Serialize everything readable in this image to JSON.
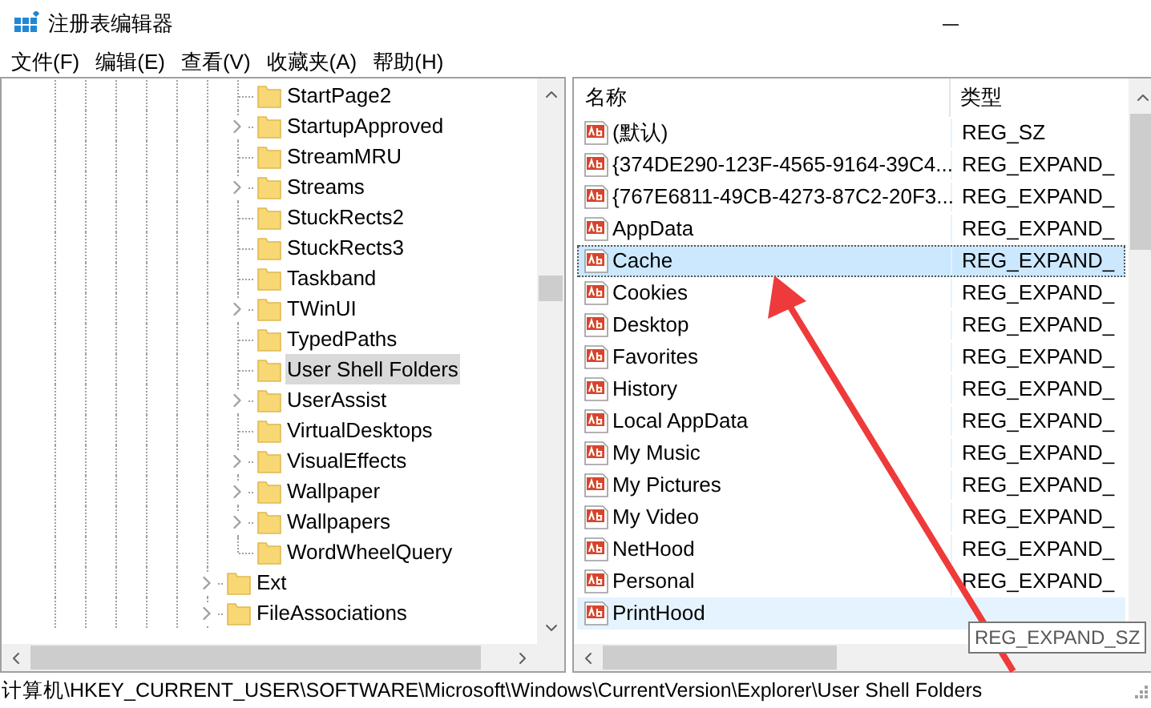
{
  "window": {
    "title": "注册表编辑器"
  },
  "menu": [
    {
      "label": "文件(F)"
    },
    {
      "label": "编辑(E)"
    },
    {
      "label": "查看(V)"
    },
    {
      "label": "收藏夹(A)"
    },
    {
      "label": "帮助(H)"
    }
  ],
  "tree": {
    "nodes": [
      {
        "children": [
          {
            "label": "StartPage2",
            "expandable": false,
            "selected": false
          },
          {
            "label": "StartupApproved",
            "expandable": true,
            "selected": false
          },
          {
            "label": "StreamMRU",
            "expandable": false,
            "selected": false
          },
          {
            "label": "Streams",
            "expandable": true,
            "selected": false
          },
          {
            "label": "StuckRects2",
            "expandable": false,
            "selected": false
          },
          {
            "label": "StuckRects3",
            "expandable": false,
            "selected": false
          },
          {
            "label": "Taskband",
            "expandable": false,
            "selected": false
          },
          {
            "label": "TWinUI",
            "expandable": true,
            "selected": false
          },
          {
            "label": "TypedPaths",
            "expandable": false,
            "selected": false
          },
          {
            "label": "User Shell Folders",
            "expandable": false,
            "selected": true
          },
          {
            "label": "UserAssist",
            "expandable": true,
            "selected": false
          },
          {
            "label": "VirtualDesktops",
            "expandable": false,
            "selected": false
          },
          {
            "label": "VisualEffects",
            "expandable": true,
            "selected": false
          },
          {
            "label": "Wallpaper",
            "expandable": true,
            "selected": false
          },
          {
            "label": "Wallpapers",
            "expandable": true,
            "selected": false
          },
          {
            "label": "WordWheelQuery",
            "expandable": false,
            "selected": false
          }
        ]
      },
      {
        "label": "Ext",
        "expandable": true,
        "selected": false
      },
      {
        "label": "FileAssociations",
        "expandable": true,
        "selected": false
      }
    ]
  },
  "values": {
    "columns": [
      "名称",
      "类型"
    ],
    "rows": [
      {
        "name": "(默认)",
        "type": "REG_SZ",
        "selected": false,
        "hovered": false
      },
      {
        "name": "{374DE290-123F-4565-9164-39C4...",
        "type": "REG_EXPAND_",
        "selected": false,
        "hovered": false
      },
      {
        "name": "{767E6811-49CB-4273-87C2-20F3...",
        "type": "REG_EXPAND_",
        "selected": false,
        "hovered": false
      },
      {
        "name": "AppData",
        "type": "REG_EXPAND_",
        "selected": false,
        "hovered": false
      },
      {
        "name": "Cache",
        "type": "REG_EXPAND_",
        "selected": true,
        "hovered": false
      },
      {
        "name": "Cookies",
        "type": "REG_EXPAND_",
        "selected": false,
        "hovered": false
      },
      {
        "name": "Desktop",
        "type": "REG_EXPAND_",
        "selected": false,
        "hovered": false
      },
      {
        "name": "Favorites",
        "type": "REG_EXPAND_",
        "selected": false,
        "hovered": false
      },
      {
        "name": "History",
        "type": "REG_EXPAND_",
        "selected": false,
        "hovered": false
      },
      {
        "name": "Local AppData",
        "type": "REG_EXPAND_",
        "selected": false,
        "hovered": false
      },
      {
        "name": "My Music",
        "type": "REG_EXPAND_",
        "selected": false,
        "hovered": false
      },
      {
        "name": "My Pictures",
        "type": "REG_EXPAND_",
        "selected": false,
        "hovered": false
      },
      {
        "name": "My Video",
        "type": "REG_EXPAND_",
        "selected": false,
        "hovered": false
      },
      {
        "name": "NetHood",
        "type": "REG_EXPAND_",
        "selected": false,
        "hovered": false
      },
      {
        "name": "Personal",
        "type": "REG_EXPAND_",
        "selected": false,
        "hovered": false
      },
      {
        "name": "PrintHood",
        "selected": false,
        "hovered": true
      }
    ]
  },
  "tooltip": "REG_EXPAND_SZ",
  "status_bar": "计算机\\HKEY_CURRENT_USER\\SOFTWARE\\Microsoft\\Windows\\CurrentVersion\\Explorer\\User Shell Folders"
}
